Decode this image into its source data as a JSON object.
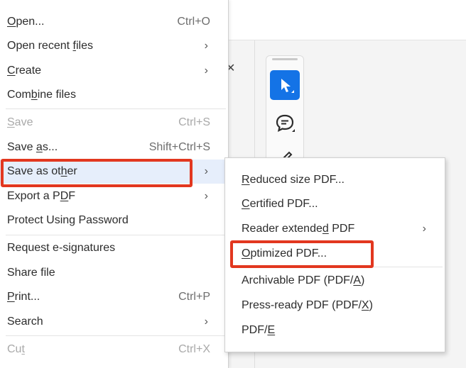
{
  "main_menu": {
    "items": [
      {
        "label_parts": [
          "",
          "O",
          "pen..."
        ],
        "shortcut": "Ctrl+O"
      },
      {
        "label_parts": [
          "Open recent ",
          "f",
          "iles"
        ],
        "arrow": "›"
      },
      {
        "label_parts": [
          "",
          "C",
          "reate"
        ],
        "arrow": "›"
      },
      {
        "label_parts": [
          "Com",
          "b",
          "ine files"
        ]
      },
      {
        "label_parts": [
          "",
          "S",
          "ave"
        ],
        "shortcut": "Ctrl+S"
      },
      {
        "label_parts": [
          "Save ",
          "a",
          "s..."
        ],
        "shortcut": "Shift+Ctrl+S"
      },
      {
        "label_parts": [
          "Save as ot",
          "h",
          "er"
        ],
        "arrow": "›"
      },
      {
        "label_parts": [
          "Export a P",
          "D",
          "F"
        ],
        "arrow": "›"
      },
      {
        "label_parts": [
          "Protect Using Password",
          "",
          ""
        ]
      },
      {
        "label_parts": [
          "Request e-signatures",
          "",
          ""
        ]
      },
      {
        "label_parts": [
          "Share file",
          "",
          ""
        ]
      },
      {
        "label_parts": [
          "",
          "P",
          "rint..."
        ],
        "shortcut": "Ctrl+P"
      },
      {
        "label_parts": [
          "Search",
          "",
          ""
        ],
        "arrow": "›"
      },
      {
        "label_parts": [
          "Cu",
          "t",
          ""
        ],
        "shortcut": "Ctrl+X"
      }
    ]
  },
  "submenu": {
    "items": [
      {
        "label_parts": [
          "",
          "R",
          "educed size PDF..."
        ]
      },
      {
        "label_parts": [
          "",
          "C",
          "ertified PDF..."
        ]
      },
      {
        "label_parts": [
          "Reader extende",
          "d",
          " PDF"
        ],
        "arrow": "›"
      },
      {
        "label_parts": [
          "",
          "O",
          "ptimized PDF..."
        ]
      },
      {
        "label_parts": [
          "Archivable PDF (PDF/",
          "A",
          ")"
        ]
      },
      {
        "label_parts": [
          "Press-ready PDF (PDF/",
          "X",
          ")"
        ]
      },
      {
        "label_parts": [
          "PDF/",
          "E",
          ""
        ]
      }
    ]
  },
  "icons": {
    "select_tool": "cursor-arrow-icon",
    "comment_tool": "comment-bubble-icon",
    "draw_tool": "pencil-icon",
    "close": "close-icon"
  },
  "colors": {
    "highlight": "#e2371f",
    "hover": "#e6eefb",
    "accent": "#1473e6",
    "disabled_text": "#a9a9a9"
  }
}
